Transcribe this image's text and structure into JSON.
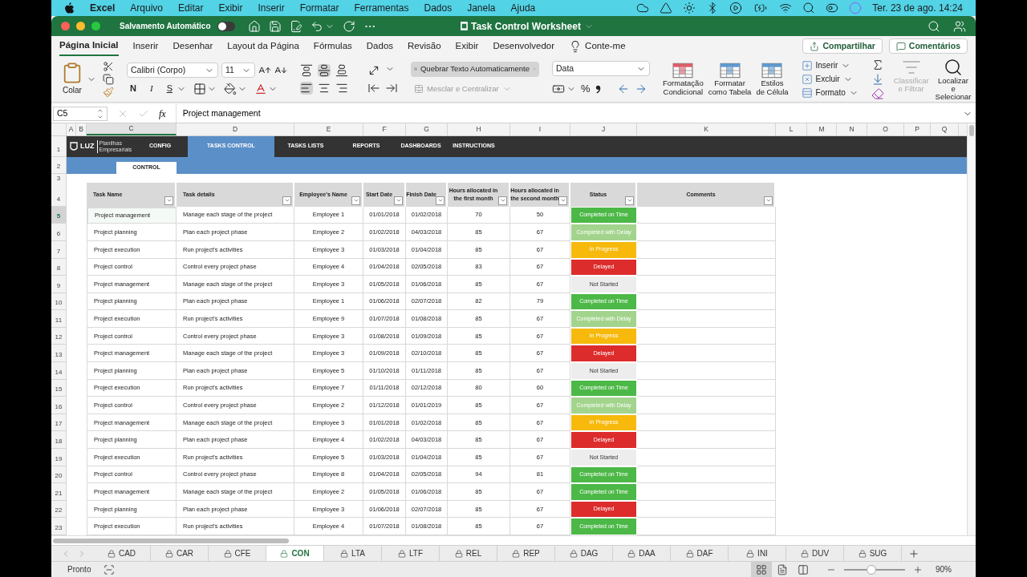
{
  "menubar": {
    "app": "Excel",
    "items": [
      "Arquivo",
      "Editar",
      "Exibir",
      "Inserir",
      "Formatar",
      "Ferramentas",
      "Dados",
      "Janela",
      "Ajuda"
    ],
    "clock": "Ter. 23 de ago.  14:24"
  },
  "window": {
    "title": "Task Control Worksheet",
    "autosave": {
      "label": "Salvamento Automático",
      "on": false
    }
  },
  "ribbon_tabs": [
    {
      "label": "Página Inicial",
      "selected": true
    },
    {
      "label": "Inserir",
      "selected": false
    },
    {
      "label": "Desenhar",
      "selected": false
    },
    {
      "label": "Layout da Página",
      "selected": false
    },
    {
      "label": "Fórmulas",
      "selected": false
    },
    {
      "label": "Dados",
      "selected": false
    },
    {
      "label": "Revisão",
      "selected": false
    },
    {
      "label": "Exibir",
      "selected": false
    },
    {
      "label": "Desenvolvedor",
      "selected": false
    }
  ],
  "tell_me": "Conte-me",
  "share": "Compartilhar",
  "comments": "Comentários",
  "ribbon": {
    "paste": "Colar",
    "font": "Calibri (Corpo)",
    "size": "11",
    "bold": "N",
    "italic": "I",
    "underline": "S",
    "wrap": "Quebrar Texto Automaticamente",
    "merge": "Mesclar e Centralizar",
    "number_format": "Data",
    "percent": "%",
    "styles": [
      {
        "line1": "Formatação",
        "line2": "Condicional"
      },
      {
        "line1": "Formatar",
        "line2": "como Tabela"
      },
      {
        "line1": "Estilos",
        "line2": "de Célula"
      }
    ],
    "cells": [
      "Inserir",
      "Excluir",
      "Formato"
    ],
    "sort": {
      "line1": "Classificar",
      "line2": "e Filtrar",
      "disabled": true
    },
    "find": {
      "line1": "Localizar e",
      "line2": "Selecionar",
      "disabled": false
    }
  },
  "formula_bar": {
    "cell": "C5",
    "fx": "fx",
    "value": "Project management"
  },
  "column_headers": [
    "A",
    "B",
    "C",
    "D",
    "E",
    "F",
    "G",
    "H",
    "I",
    "J",
    "K",
    "L",
    "M",
    "N",
    "O",
    "P",
    "Q"
  ],
  "sheet_nav": {
    "logo": "LUZ",
    "tagline": "Planilhas Empresariais",
    "items": [
      {
        "label": "CONFIG",
        "selected": false
      },
      {
        "label": "TASKS CONTROL",
        "selected": true
      },
      {
        "label": "TASKS LISTS",
        "selected": false
      },
      {
        "label": "REPORTS",
        "selected": false
      },
      {
        "label": "DASHBOARDS",
        "selected": false
      },
      {
        "label": "INSTRUCTIONS",
        "selected": false
      }
    ]
  },
  "section_tab": "CONTROL",
  "table": {
    "columns": [
      "Task Name",
      "Task details",
      "Employee's Name",
      "Start Date",
      "Finish Date",
      "Hours allocated in the first month",
      "Hours allocated in the second month",
      "Status",
      "Comments"
    ],
    "rows": [
      {
        "n": "5",
        "task": "Project management",
        "details": "Manage each stage of the project",
        "employee": "Employee 1",
        "start": "01/01/2018",
        "finish": "01/02/2018",
        "h1": "70",
        "h2": "50",
        "status": "Completed on Time",
        "kind": "on_time",
        "selected": true
      },
      {
        "n": "6",
        "task": "Project planning",
        "details": "Plan each project phase",
        "employee": "Employee 2",
        "start": "01/02/2018",
        "finish": "04/03/2018",
        "h1": "85",
        "h2": "67",
        "status": "Completed with Delay",
        "kind": "late_done",
        "selected": false
      },
      {
        "n": "7",
        "task": "Project execution",
        "details": "Run project's activities",
        "employee": "Employee 3",
        "start": "01/03/2018",
        "finish": "01/04/2018",
        "h1": "85",
        "h2": "67",
        "status": "In Progress",
        "kind": "progress",
        "selected": false
      },
      {
        "n": "8",
        "task": "Project control",
        "details": "Control every project phase",
        "employee": "Employee 4",
        "start": "01/04/2018",
        "finish": "02/05/2018",
        "h1": "83",
        "h2": "67",
        "status": "Delayed",
        "kind": "delayed",
        "selected": false
      },
      {
        "n": "9",
        "task": "Project management",
        "details": "Manage each stage of the project",
        "employee": "Employee 3",
        "start": "01/05/2018",
        "finish": "01/06/2018",
        "h1": "85",
        "h2": "67",
        "status": "Not Started",
        "kind": "not_started",
        "selected": false
      },
      {
        "n": "10",
        "task": "Project planning",
        "details": "Plan each project phase",
        "employee": "Employee 1",
        "start": "01/06/2018",
        "finish": "02/07/2018",
        "h1": "82",
        "h2": "79",
        "status": "Completed on Time",
        "kind": "on_time",
        "selected": false
      },
      {
        "n": "11",
        "task": "Project execution",
        "details": "Run project's activities",
        "employee": "Employee 9",
        "start": "01/07/2018",
        "finish": "01/08/2018",
        "h1": "85",
        "h2": "67",
        "status": "Completed with Delay",
        "kind": "late_done",
        "selected": false
      },
      {
        "n": "12",
        "task": "Project control",
        "details": "Control every project phase",
        "employee": "Employee 3",
        "start": "01/08/2018",
        "finish": "01/09/2018",
        "h1": "85",
        "h2": "67",
        "status": "In Progress",
        "kind": "progress",
        "selected": false
      },
      {
        "n": "13",
        "task": "Project management",
        "details": "Manage each stage of the project",
        "employee": "Employee 3",
        "start": "01/09/2018",
        "finish": "02/10/2018",
        "h1": "85",
        "h2": "67",
        "status": "Delayed",
        "kind": "delayed",
        "selected": false
      },
      {
        "n": "14",
        "task": "Project planning",
        "details": "Plan each project phase",
        "employee": "Employee 5",
        "start": "01/10/2018",
        "finish": "01/11/2018",
        "h1": "85",
        "h2": "67",
        "status": "Not Started",
        "kind": "not_started",
        "selected": false
      },
      {
        "n": "15",
        "task": "Project execution",
        "details": "Run project's activities",
        "employee": "Employee 7",
        "start": "01/11/2018",
        "finish": "02/12/2018",
        "h1": "80",
        "h2": "60",
        "status": "Completed on Time",
        "kind": "on_time",
        "selected": false
      },
      {
        "n": "16",
        "task": "Project control",
        "details": "Control every project phase",
        "employee": "Employee 2",
        "start": "01/12/2018",
        "finish": "01/01/2019",
        "h1": "85",
        "h2": "67",
        "status": "Completed with Delay",
        "kind": "late_done",
        "selected": false
      },
      {
        "n": "17",
        "task": "Project management",
        "details": "Manage each stage of the project",
        "employee": "Employee 3",
        "start": "01/01/2018",
        "finish": "01/02/2018",
        "h1": "85",
        "h2": "67",
        "status": "In Progress",
        "kind": "progress",
        "selected": false
      },
      {
        "n": "18",
        "task": "Project planning",
        "details": "Plan each project phase",
        "employee": "Employee 4",
        "start": "01/02/2018",
        "finish": "04/03/2018",
        "h1": "85",
        "h2": "67",
        "status": "Delayed",
        "kind": "delayed",
        "selected": false
      },
      {
        "n": "19",
        "task": "Project execution",
        "details": "Run project's activities",
        "employee": "Employee 5",
        "start": "01/03/2018",
        "finish": "01/04/2018",
        "h1": "85",
        "h2": "67",
        "status": "Not Started",
        "kind": "not_started",
        "selected": false
      },
      {
        "n": "20",
        "task": "Project control",
        "details": "Control every project phase",
        "employee": "Employee 8",
        "start": "01/04/2018",
        "finish": "02/05/2018",
        "h1": "94",
        "h2": "81",
        "status": "Completed on Time",
        "kind": "on_time",
        "selected": false
      },
      {
        "n": "21",
        "task": "Project management",
        "details": "Manage each stage of the project",
        "employee": "Employee 2",
        "start": "01/05/2018",
        "finish": "01/06/2018",
        "h1": "85",
        "h2": "67",
        "status": "Completed on Time",
        "kind": "on_time",
        "selected": false
      },
      {
        "n": "22",
        "task": "Project planning",
        "details": "Plan each project phase",
        "employee": "Employee 3",
        "start": "01/06/2018",
        "finish": "02/07/2018",
        "h1": "85",
        "h2": "67",
        "status": "Delayed",
        "kind": "delayed",
        "selected": false
      },
      {
        "n": "23",
        "task": "Project execution",
        "details": "Run project's activities",
        "employee": "Employee 4",
        "start": "01/07/2018",
        "finish": "01/08/2018",
        "h1": "85",
        "h2": "67",
        "status": "Completed on Time",
        "kind": "on_time",
        "selected": false
      }
    ]
  },
  "top_row_numbers": [
    "1",
    "2",
    "3",
    "4"
  ],
  "sheet_tabs": [
    {
      "label": "CAD",
      "selected": false
    },
    {
      "label": "CAR",
      "selected": false
    },
    {
      "label": "CFE",
      "selected": false
    },
    {
      "label": "CON",
      "selected": true
    },
    {
      "label": "LTA",
      "selected": false
    },
    {
      "label": "LTF",
      "selected": false
    },
    {
      "label": "REL",
      "selected": false
    },
    {
      "label": "REP",
      "selected": false
    },
    {
      "label": "DAG",
      "selected": false
    },
    {
      "label": "DAA",
      "selected": false
    },
    {
      "label": "DAF",
      "selected": false
    },
    {
      "label": "INI",
      "selected": false
    },
    {
      "label": "DUV",
      "selected": false
    },
    {
      "label": "SUG",
      "selected": false
    }
  ],
  "status_bar": {
    "status": "Pronto",
    "zoom": "90%",
    "zoom_slider": {
      "level": 0.45
    }
  }
}
